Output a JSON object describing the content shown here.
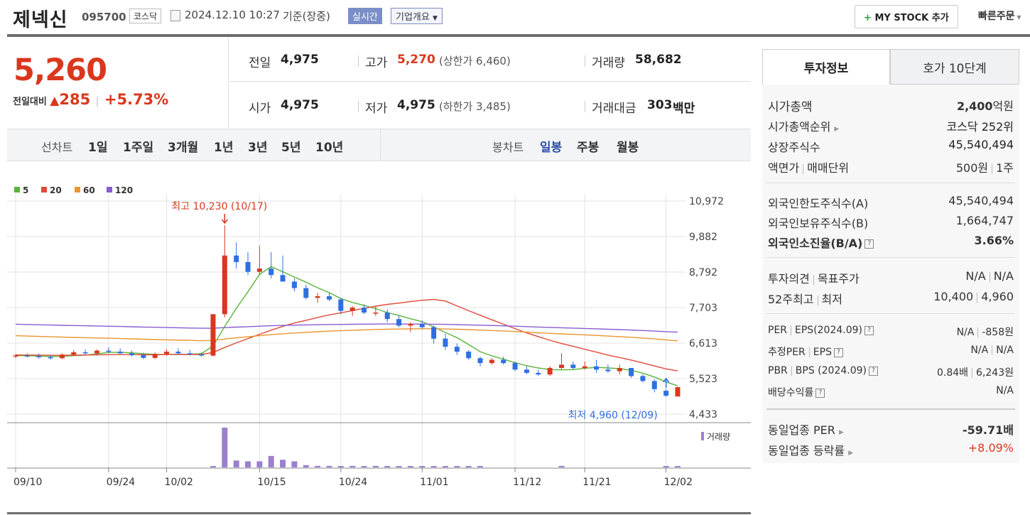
{
  "header": {
    "stock_name": "제넥신",
    "stock_code": "095700",
    "market": "코스닥",
    "datetime": "2024.12.10 10:27",
    "basis": "기준(장중)",
    "realtime": "실시간",
    "company_info": "기업개요",
    "mystock_button": "MY STOCK 추가",
    "quick_order": "빠른주문"
  },
  "quote": {
    "price": "5,260",
    "change_label": "전일대비",
    "change": "285",
    "change_pct": "+5.73%",
    "prev_label": "전일",
    "prev": "4,975",
    "high_label": "고가",
    "high": "5,270",
    "upper_limit": "(상한가 6,460)",
    "volume_label": "거래량",
    "volume": "58,682",
    "open_label": "시가",
    "open": "4,975",
    "low_label": "저가",
    "low": "4,975",
    "lower_limit": "(하한가 3,485)",
    "amount_label": "거래대금",
    "amount": "303",
    "amount_unit": "백만"
  },
  "chart_tabs": {
    "line_label": "선차트",
    "line_items": [
      "1일",
      "1주일",
      "3개월",
      "1년",
      "3년",
      "5년",
      "10년"
    ],
    "candle_label": "봉차트",
    "candle_items": [
      "일봉",
      "주봉",
      "월봉"
    ],
    "candle_selected": "일봉"
  },
  "chart_data": {
    "type": "candlestick",
    "legend": [
      "5",
      "20",
      "60",
      "120"
    ],
    "legend_colors": [
      "#5bb33d",
      "#e04a3a",
      "#e8962e",
      "#8a5cd1"
    ],
    "y_ticks": [
      "10,972",
      "9,882",
      "8,792",
      "7,703",
      "6,613",
      "5,523",
      "4,433"
    ],
    "ylim": [
      4433,
      10972
    ],
    "x_ticks": [
      "09/10",
      "09/24",
      "10/02",
      "10/15",
      "10/24",
      "11/01",
      "11/12",
      "11/21",
      "12/02"
    ],
    "high_annotation": "최고 10,230 (10/17)",
    "low_annotation": "최저 4,960 (12/09)",
    "volume_label": "거래량",
    "candles": [
      [
        6200,
        6280,
        6150,
        6230
      ],
      [
        6230,
        6300,
        6180,
        6210
      ],
      [
        6210,
        6290,
        6140,
        6180
      ],
      [
        6180,
        6260,
        6100,
        6150
      ],
      [
        6150,
        6300,
        6120,
        6260
      ],
      [
        6260,
        6400,
        6220,
        6330
      ],
      [
        6330,
        6420,
        6260,
        6300
      ],
      [
        6300,
        6420,
        6250,
        6380
      ],
      [
        6380,
        6480,
        6300,
        6350
      ],
      [
        6350,
        6450,
        6280,
        6300
      ],
      [
        6300,
        6380,
        6200,
        6240
      ],
      [
        6240,
        6320,
        6120,
        6160
      ],
      [
        6160,
        6320,
        6120,
        6280
      ],
      [
        6280,
        6420,
        6220,
        6350
      ],
      [
        6350,
        6450,
        6250,
        6300
      ],
      [
        6300,
        6400,
        6230,
        6270
      ],
      [
        6270,
        6320,
        6200,
        6230
      ],
      [
        6230,
        7400,
        6200,
        7500
      ],
      [
        7500,
        10230,
        7400,
        9300
      ],
      [
        9300,
        9700,
        8900,
        9100
      ],
      [
        9100,
        9400,
        8700,
        8800
      ],
      [
        8800,
        9600,
        8700,
        8900
      ],
      [
        8900,
        9400,
        8600,
        8700
      ],
      [
        8700,
        9300,
        8500,
        8500
      ],
      [
        8500,
        8600,
        8200,
        8300
      ],
      [
        8300,
        8400,
        7950,
        8000
      ],
      [
        8000,
        8150,
        7850,
        8050
      ],
      [
        8050,
        8150,
        7900,
        7950
      ],
      [
        7950,
        8000,
        7500,
        7600
      ],
      [
        7600,
        7750,
        7450,
        7700
      ],
      [
        7700,
        7800,
        7500,
        7550
      ],
      [
        7550,
        7750,
        7450,
        7550
      ],
      [
        7550,
        7650,
        7250,
        7350
      ],
      [
        7350,
        7450,
        7100,
        7150
      ],
      [
        7150,
        7250,
        6950,
        7200
      ],
      [
        7200,
        7300,
        7050,
        7100
      ],
      [
        7100,
        7150,
        6600,
        6750
      ],
      [
        6750,
        6900,
        6400,
        6500
      ],
      [
        6500,
        6600,
        6250,
        6350
      ],
      [
        6350,
        6400,
        6100,
        6150
      ],
      [
        6150,
        6200,
        5900,
        6000
      ],
      [
        6000,
        6150,
        5950,
        6100
      ],
      [
        6100,
        6200,
        5950,
        6000
      ],
      [
        6000,
        6050,
        5750,
        5800
      ],
      [
        5800,
        5900,
        5650,
        5700
      ],
      [
        5700,
        5800,
        5600,
        5650
      ],
      [
        5650,
        5900,
        5600,
        5850
      ],
      [
        5850,
        6300,
        5800,
        5950
      ],
      [
        5950,
        6050,
        5800,
        5850
      ],
      [
        5850,
        6050,
        5800,
        5900
      ],
      [
        5900,
        6100,
        5700,
        5800
      ],
      [
        5800,
        5950,
        5700,
        5750
      ],
      [
        5750,
        5950,
        5650,
        5850
      ],
      [
        5850,
        5850,
        5550,
        5600
      ],
      [
        5600,
        5650,
        5400,
        5450
      ],
      [
        5450,
        5500,
        5100,
        5200
      ],
      [
        5150,
        5200,
        4960,
        5000
      ],
      [
        4975,
        5270,
        4975,
        5260
      ]
    ],
    "volumes": [
      0,
      0,
      0,
      0,
      0,
      0,
      0,
      0,
      0,
      0,
      0,
      0,
      0,
      0,
      0,
      0,
      0,
      1,
      52,
      9,
      8,
      8,
      15,
      10,
      8,
      3,
      2,
      2,
      1,
      2,
      1,
      2,
      1,
      1,
      1,
      1,
      1,
      1,
      1,
      1,
      1,
      0,
      0,
      0,
      0,
      0,
      0,
      2,
      0,
      0,
      0,
      0,
      0,
      0,
      0,
      0,
      1,
      1
    ]
  },
  "invest": {
    "tab_info": "투자정보",
    "tab_ask": "호가 10단계",
    "market_cap_label": "시가총액",
    "market_cap": "2,400",
    "market_cap_unit": "억원",
    "rank_label": "시가총액순위",
    "rank": "코스닥 252위",
    "shares_label": "상장주식수",
    "shares": "45,540,494",
    "par_label": "액면가",
    "unit_label": "매매단위",
    "par": "500원",
    "unit": "1주",
    "foreign_limit_label": "외국인한도주식수(A)",
    "foreign_limit": "45,540,494",
    "foreign_hold_label": "외국인보유주식수(B)",
    "foreign_hold": "1,664,747",
    "foreign_rate_label": "외국인소진율(B/A)",
    "foreign_rate": "3.66%",
    "opinion_label": "투자의견",
    "target_label": "목표주가",
    "opinion": "N/A",
    "target": "N/A",
    "w52_label": "52주최고",
    "w52_low_label": "최저",
    "w52_high": "10,400",
    "w52_low": "4,960",
    "per_label": "PER",
    "eps_label": "EPS(2024.09)",
    "per": "N/A",
    "eps": "-858원",
    "est_per_label": "추정PER",
    "est_eps_label": "EPS",
    "est_per": "N/A",
    "est_eps": "N/A",
    "pbr_label": "PBR",
    "bps_label": "BPS (2024.09)",
    "pbr": "0.84배",
    "bps": "6,243원",
    "div_label": "배당수익률",
    "div": "N/A",
    "sector_per_label": "동일업종 PER",
    "sector_per": "-59.71배",
    "sector_rate_label": "동일업종 등락률",
    "sector_rate": "+8.09%"
  }
}
